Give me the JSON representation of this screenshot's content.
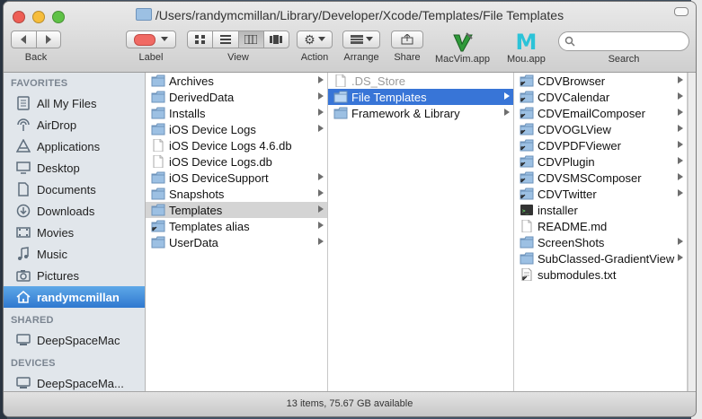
{
  "window": {
    "title": "/Users/randymcmillan/Library/Developer/Xcode/Templates/File Templates"
  },
  "toolbar": {
    "back_label": "Back",
    "label_label": "Label",
    "view_label": "View",
    "action_label": "Action",
    "arrange_label": "Arrange",
    "share_label": "Share",
    "macvim_label": "MacVim.app",
    "mou_label": "Mou.app",
    "search_label": "Search",
    "search_placeholder": ""
  },
  "sidebar": {
    "favorites_header": "FAVORITES",
    "favorites": [
      {
        "label": "All My Files",
        "icon": "all-files-icon"
      },
      {
        "label": "AirDrop",
        "icon": "airdrop-icon"
      },
      {
        "label": "Applications",
        "icon": "applications-icon"
      },
      {
        "label": "Desktop",
        "icon": "desktop-icon"
      },
      {
        "label": "Documents",
        "icon": "documents-icon"
      },
      {
        "label": "Downloads",
        "icon": "downloads-icon"
      },
      {
        "label": "Movies",
        "icon": "movies-icon"
      },
      {
        "label": "Music",
        "icon": "music-icon"
      },
      {
        "label": "Pictures",
        "icon": "pictures-icon"
      },
      {
        "label": "randymcmillan",
        "icon": "home-icon",
        "selected": true
      }
    ],
    "shared_header": "SHARED",
    "shared": [
      {
        "label": "DeepSpaceMac",
        "icon": "computer-icon"
      }
    ],
    "devices_header": "DEVICES",
    "devices": [
      {
        "label": "DeepSpaceMa...",
        "icon": "computer-icon"
      }
    ]
  },
  "column1": [
    {
      "label": "Archives",
      "type": "folder",
      "arrow": true
    },
    {
      "label": "DerivedData",
      "type": "folder",
      "arrow": true
    },
    {
      "label": "Installs",
      "type": "folder",
      "arrow": true
    },
    {
      "label": "iOS Device Logs",
      "type": "folder",
      "arrow": true
    },
    {
      "label": "iOS Device Logs 4.6.db",
      "type": "file",
      "arrow": false
    },
    {
      "label": "iOS Device Logs.db",
      "type": "file",
      "arrow": false
    },
    {
      "label": "iOS DeviceSupport",
      "type": "folder",
      "arrow": true
    },
    {
      "label": "Snapshots",
      "type": "folder",
      "arrow": true
    },
    {
      "label": "Templates",
      "type": "folder",
      "arrow": true,
      "selected": "gray"
    },
    {
      "label": "Templates alias",
      "type": "alias",
      "arrow": true
    },
    {
      "label": "UserData",
      "type": "folder",
      "arrow": true
    }
  ],
  "column2": [
    {
      "label": ".DS_Store",
      "type": "file",
      "arrow": false,
      "dim": true
    },
    {
      "label": "File Templates",
      "type": "folder",
      "arrow": true,
      "selected": "blue"
    },
    {
      "label": "Framework & Library",
      "type": "folder",
      "arrow": true
    }
  ],
  "column3": [
    {
      "label": "CDVBrowser",
      "type": "alias",
      "arrow": true
    },
    {
      "label": "CDVCalendar",
      "type": "alias",
      "arrow": true
    },
    {
      "label": "CDVEmailComposer",
      "type": "alias",
      "arrow": true
    },
    {
      "label": "CDVOGLView",
      "type": "alias",
      "arrow": true
    },
    {
      "label": "CDVPDFViewer",
      "type": "alias",
      "arrow": true
    },
    {
      "label": "CDVPlugin",
      "type": "alias",
      "arrow": true
    },
    {
      "label": "CDVSMSComposer",
      "type": "alias",
      "arrow": true
    },
    {
      "label": "CDVTwitter",
      "type": "alias",
      "arrow": true
    },
    {
      "label": "installer",
      "type": "exec",
      "arrow": false
    },
    {
      "label": "README.md",
      "type": "file",
      "arrow": false
    },
    {
      "label": "ScreenShots",
      "type": "folder",
      "arrow": true
    },
    {
      "label": "SubClassed-GradientView",
      "type": "folder",
      "arrow": true
    },
    {
      "label": "submodules.txt",
      "type": "textfile",
      "arrow": false
    }
  ],
  "status": {
    "text": "13 items, 75.67 GB available"
  },
  "colors": {
    "selection_blue": "#3875d7",
    "sidebar_selected": "#2f78cf",
    "folder": "#9cc0e3"
  }
}
